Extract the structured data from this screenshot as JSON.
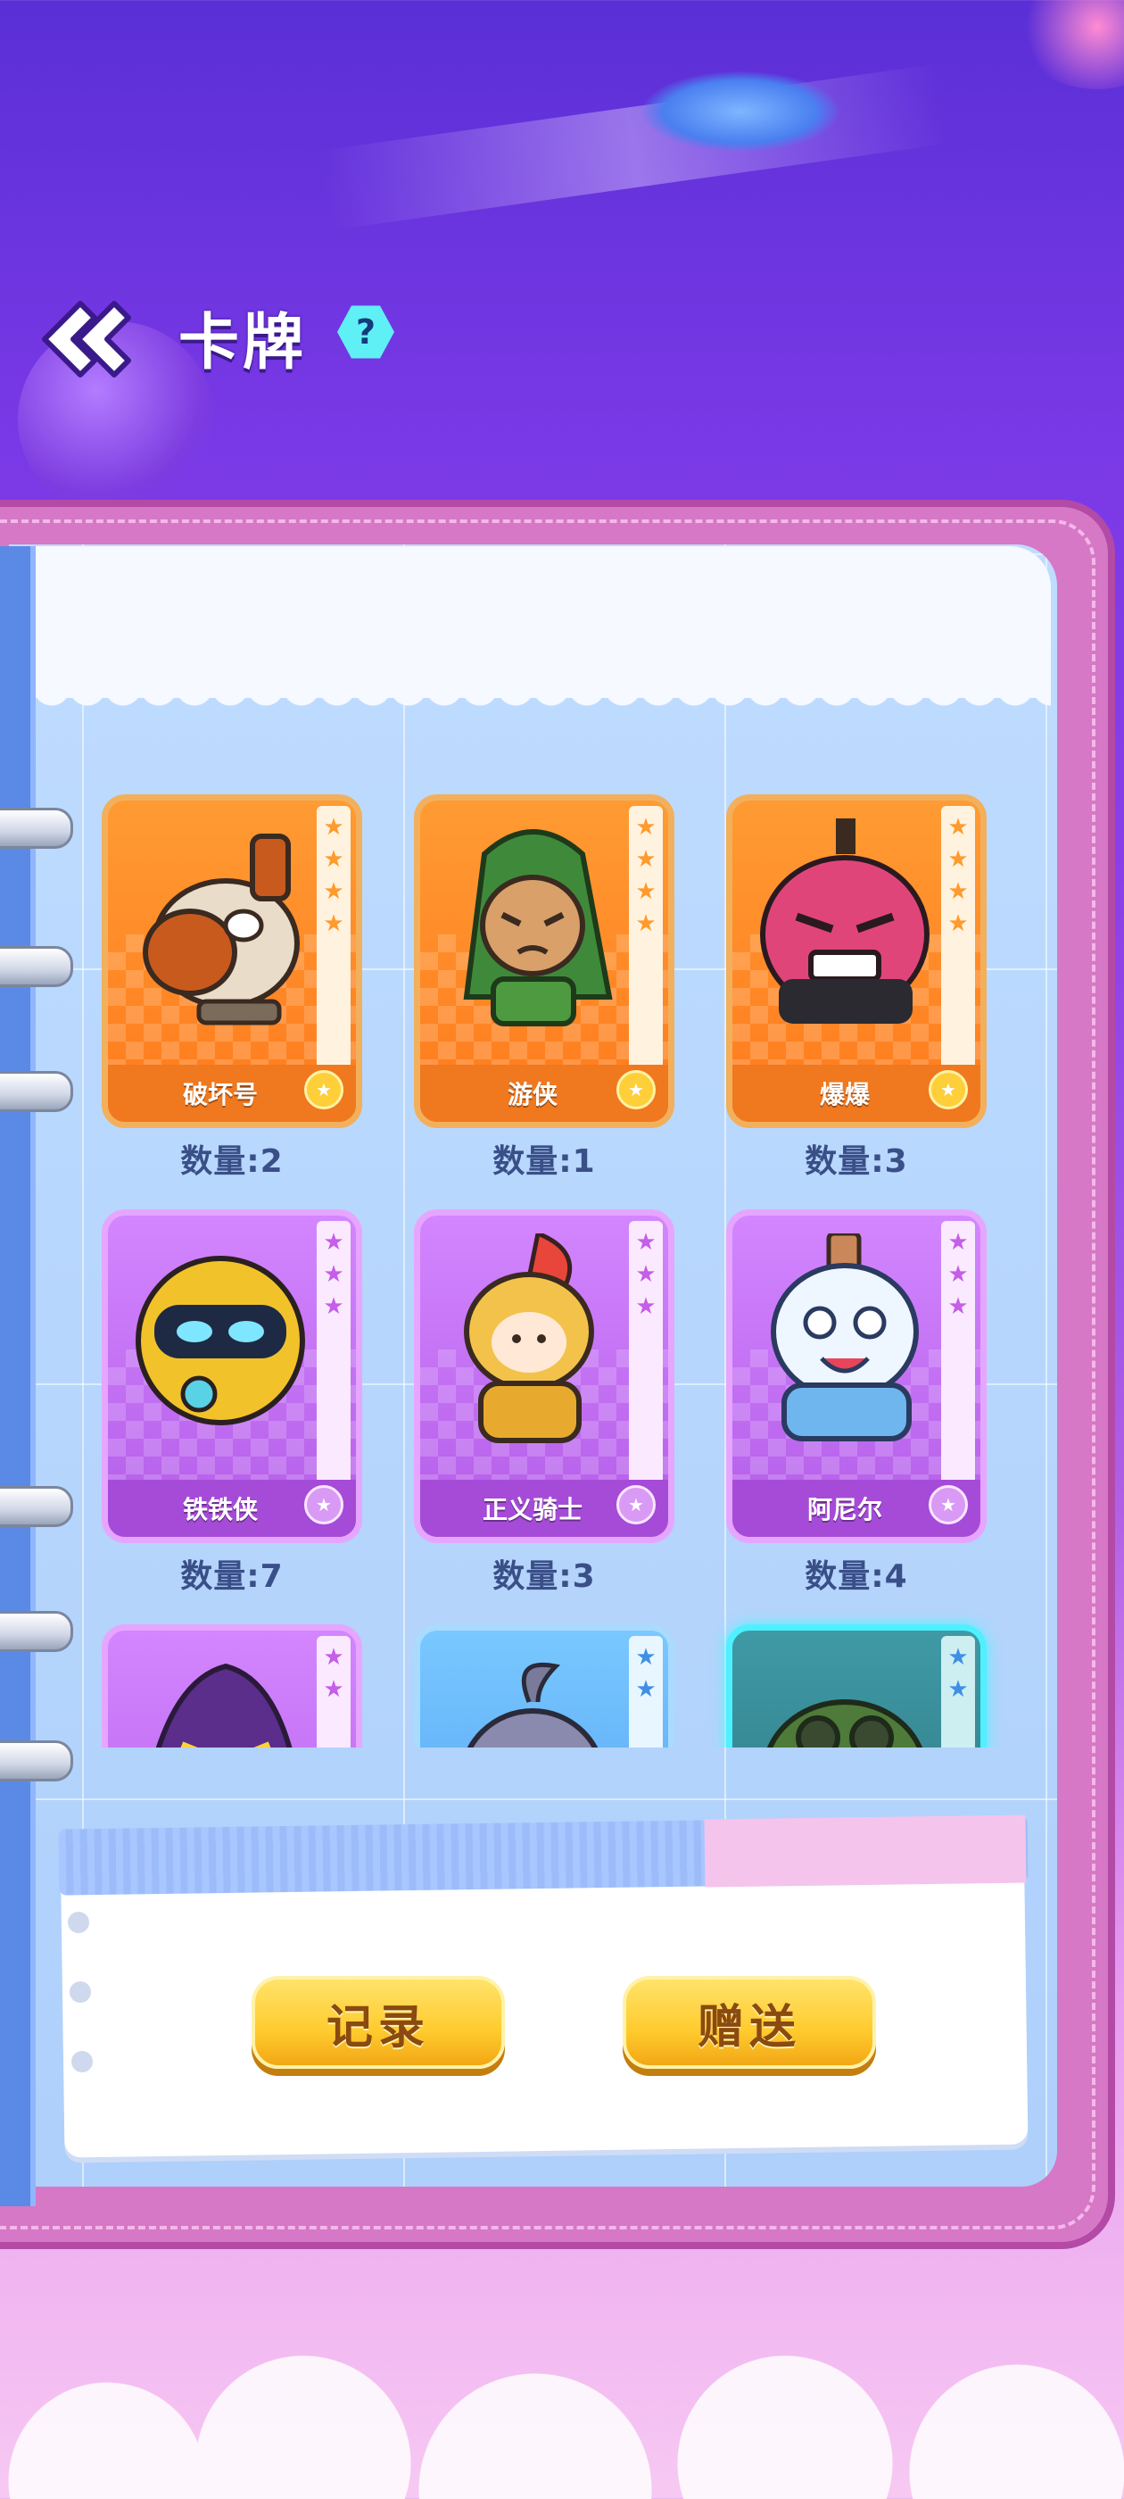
{
  "header": {
    "title": "卡牌",
    "help_icon_label": "?"
  },
  "cards": [
    {
      "name": "破坏号",
      "quantity": "数量:2",
      "theme": "orange",
      "stars": 4,
      "art": "robot-fish-icon"
    },
    {
      "name": "游侠",
      "quantity": "数量:1",
      "theme": "orange",
      "stars": 4,
      "art": "ranger-icon"
    },
    {
      "name": "爆爆",
      "quantity": "数量:3",
      "theme": "orange",
      "stars": 4,
      "art": "bomb-monster-icon"
    },
    {
      "name": "铁铁侠",
      "quantity": "数量:7",
      "theme": "purple",
      "stars": 3,
      "art": "iron-robot-icon"
    },
    {
      "name": "正义骑士",
      "quantity": "数量:3",
      "theme": "purple",
      "stars": 3,
      "art": "knight-icon"
    },
    {
      "name": "阿尼尔",
      "quantity": "数量:4",
      "theme": "purple",
      "stars": 3,
      "art": "bottle-creature-icon"
    },
    {
      "name": "",
      "quantity": "",
      "theme": "purple",
      "stars": 2,
      "art": "hooded-villain-icon"
    },
    {
      "name": "",
      "quantity": "",
      "theme": "blue",
      "stars": 2,
      "art": "sprout-creature-icon"
    },
    {
      "name": "",
      "quantity": "",
      "theme": "teal",
      "stars": 2,
      "art": "gasmask-frog-icon"
    }
  ],
  "actions": {
    "record_label": "记录",
    "gift_label": "赠送"
  },
  "colors": {
    "background_top": "#5a2fd6",
    "binder_pink": "#d678c6",
    "page_blue": "#b7d8ff",
    "button_yellow": "#ffcb2e"
  }
}
